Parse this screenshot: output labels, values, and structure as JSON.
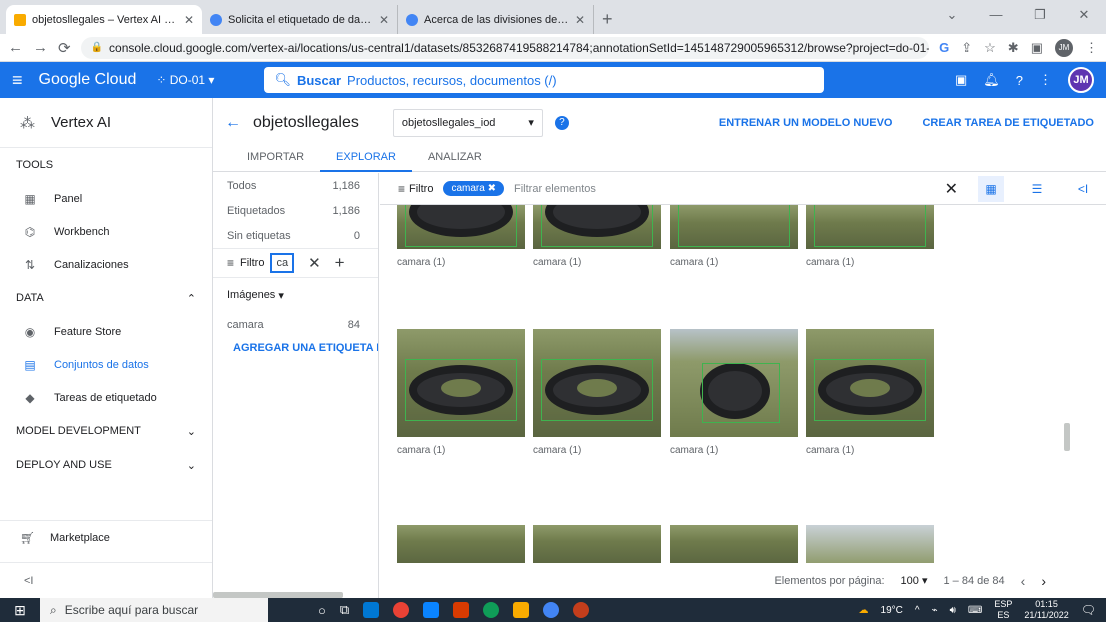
{
  "browser": {
    "tabs": [
      {
        "title": "objetosllegales – Vertex AI – DO-",
        "color": "#f9ab00",
        "active": true
      },
      {
        "title": "Solicita el etiquetado de datos d",
        "color": "#4285f4",
        "active": false
      },
      {
        "title": "Acerca de las divisiones de datos",
        "color": "#4285f4",
        "active": false
      }
    ],
    "new_tab": "+",
    "url": "console.cloud.google.com/vertex-ai/locations/us-central1/datasets/8532687419588214784;annotationSetId=145148729005965312/browse?project=do-01-3...",
    "profile_initials": "JM"
  },
  "gc_header": {
    "brand": "Google Cloud",
    "project": "DO-01",
    "search_label": "Buscar",
    "search_placeholder": "Productos, recursos, documentos (/)",
    "avatar": "JM"
  },
  "sidebar": {
    "product": "Vertex AI",
    "sections": [
      {
        "label": "TOOLS"
      },
      {
        "label": "DATA"
      },
      {
        "label": "MODEL DEVELOPMENT"
      },
      {
        "label": "DEPLOY AND USE"
      }
    ],
    "tools_items": [
      {
        "label": "Panel",
        "icon": "dashboard-icon"
      },
      {
        "label": "Workbench",
        "icon": "workbench-icon"
      },
      {
        "label": "Canalizaciones",
        "icon": "pipelines-icon"
      }
    ],
    "data_items": [
      {
        "label": "Feature Store",
        "icon": "feature-store-icon"
      },
      {
        "label": "Conjuntos de datos",
        "icon": "datasets-icon",
        "selected": true
      },
      {
        "label": "Tareas de etiquetado",
        "icon": "labeling-icon"
      }
    ],
    "marketplace": "Marketplace",
    "collapse": "<I"
  },
  "header": {
    "title": "objetosllegales",
    "dataset_select": "objetosllegales_iod",
    "train_action": "ENTRENAR UN MODELO NUEVO",
    "label_action": "CREAR TAREA DE ETIQUETADO"
  },
  "tabs": [
    "IMPORTAR",
    "EXPLORAR",
    "ANALIZAR"
  ],
  "filters": {
    "counts": [
      {
        "label": "Todos",
        "value": "1,186"
      },
      {
        "label": "Etiquetados",
        "value": "1,186"
      },
      {
        "label": "Sin etiquetas",
        "value": "0"
      }
    ],
    "filter_label": "Filtro",
    "filter_value": "ca",
    "images_header": "Imágenes",
    "labels": [
      {
        "label": "camara",
        "count": "84"
      }
    ],
    "add_label": "AGREGAR UNA ETIQUETA NUEVA"
  },
  "grid": {
    "filter_label": "Filtro",
    "chip": "camara",
    "filter_placeholder": "Filtrar elementos",
    "captions": [
      "camara (1)",
      "camara (1)",
      "camara (1)",
      "camara (1)",
      "camara (1)",
      "camara (1)",
      "camara (1)",
      "camara (1)"
    ]
  },
  "pager": {
    "per_page_label": "Elementos por página:",
    "per_page": "100",
    "range": "1 – 84 de 84"
  },
  "taskbar": {
    "search": "Escribe aquí para buscar",
    "weather": "19°C",
    "lang": "ESP",
    "lang2": "ES",
    "time": "01:15",
    "date": "21/11/2022"
  }
}
